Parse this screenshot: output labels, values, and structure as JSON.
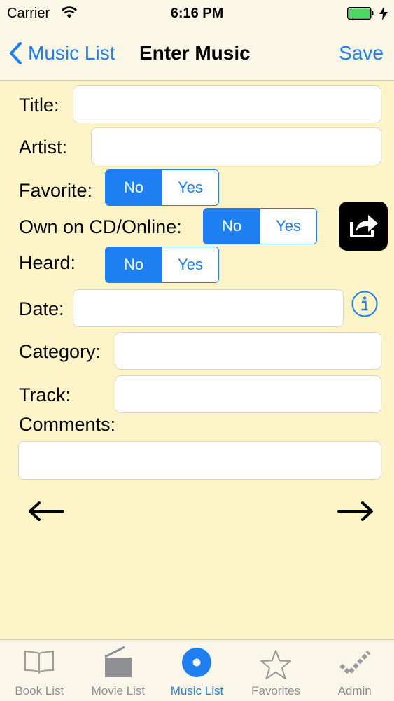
{
  "status": {
    "carrier": "Carrier",
    "time": "6:16 PM"
  },
  "nav": {
    "back_label": "Music List",
    "title": "Enter Music",
    "save_label": "Save"
  },
  "form": {
    "title_label": "Title:",
    "title_value": "",
    "artist_label": "Artist:",
    "artist_value": "",
    "favorite_label": "Favorite:",
    "favorite_options": [
      "No",
      "Yes"
    ],
    "favorite_selected": "No",
    "own_label": "Own on CD/Online:",
    "own_options": [
      "No",
      "Yes"
    ],
    "own_selected": "No",
    "heard_label": "Heard:",
    "heard_options": [
      "No",
      "Yes"
    ],
    "heard_selected": "No",
    "date_label": "Date:",
    "date_value": "",
    "category_label": "Category:",
    "category_value": "",
    "track_label": "Track:",
    "track_value": "",
    "comments_label": "Comments:",
    "comments_value": ""
  },
  "tabs": [
    {
      "label": "Book List",
      "icon": "book-icon",
      "active": false
    },
    {
      "label": "Movie List",
      "icon": "clapperboard-icon",
      "active": false
    },
    {
      "label": "Music List",
      "icon": "disc-icon",
      "active": true
    },
    {
      "label": "Favorites",
      "icon": "star-icon",
      "active": false
    },
    {
      "label": "Admin",
      "icon": "checkmark-icon",
      "active": false
    }
  ],
  "colors": {
    "accent": "#1d7ff2",
    "background": "#fdf4c7",
    "battery": "#4cd964"
  }
}
